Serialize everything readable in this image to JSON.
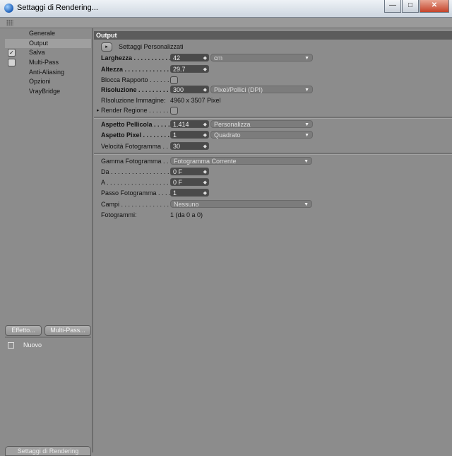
{
  "window": {
    "title": "Settaggi di Rendering...",
    "minimize_glyph": "—",
    "maximize_glyph": "□",
    "close_glyph": "✕"
  },
  "sidebar": {
    "items": [
      {
        "label": "Generale",
        "checkbox": false
      },
      {
        "label": "Output",
        "checkbox": false,
        "selected": true
      },
      {
        "label": "Salva",
        "checkbox": true,
        "checked": true,
        "check_glyph": "✓"
      },
      {
        "label": "Multi-Pass",
        "checkbox": true,
        "checked": false
      },
      {
        "label": "Anti-Aliasing",
        "checkbox": false
      },
      {
        "label": "Opzioni",
        "checkbox": false
      },
      {
        "label": "VrayBridge",
        "checkbox": false
      }
    ],
    "effetto_button": "Effetto...",
    "multipass_button": "Multi-Pass...",
    "preset_label": "Nuovo",
    "bottom_tab": "Settaggi di Rendering"
  },
  "output": {
    "header": "Output",
    "preset_button_glyph": "▸",
    "preset_label": "Settaggi  Personalizzati",
    "larghezza_label": "Larghezza . . . . . . . . . . . . .",
    "larghezza_value": "42",
    "unit_value": "cm",
    "altezza_label": "Altezza . . . . . . . . . . . . . . .",
    "altezza_value": "29.7",
    "blocca_label": "Blocca Rapporto . . . . . . . .",
    "risoluzione_label": "Risoluzione . . . . . . . . . .",
    "risoluzione_value": "300",
    "risoluzione_unit": "Pixel/Pollici (DPI)",
    "risoluzione_immagine_label": "RIsoluzione Immagine:",
    "risoluzione_immagine_value": "4960 x 3507 Pixel",
    "render_regione_glyph": "▸",
    "render_regione_label": "Render Regione . . . . . . . .",
    "aspetto_pellicola_label": "Aspetto Pellicola . . . . .",
    "aspetto_pellicola_value": "1.414",
    "aspetto_pellicola_mode": "Personalizza",
    "aspetto_pixel_label": "Aspetto Pixel . . . . . . . . .",
    "aspetto_pixel_value": "1",
    "aspetto_pixel_mode": "Quadrato",
    "velocita_label": "Velocità Fotogramma . . .",
    "velocita_value": "30",
    "gamma_label": "Gamma Fotogramma . . . .",
    "gamma_value": "Fotogramma Corrente",
    "da_label": "Da . . . . . . . . . . . . . . . . . . . .",
    "da_value": "0 F",
    "a_label": "A . . . . . . . . . . . . . . . . . . . . .",
    "a_value": "0 F",
    "passo_label": "Passo Fotogramma . . . . . .",
    "passo_value": "1",
    "campi_label": "Campi . . . . . . . . . . . . . . . . .",
    "campi_value": "Nessuno",
    "fotogrammi_label": "Fotogrammi:",
    "fotogrammi_value": "1 (da 0 a 0)",
    "spin_glyph": "◆",
    "dropdown_glyph": "▼"
  }
}
